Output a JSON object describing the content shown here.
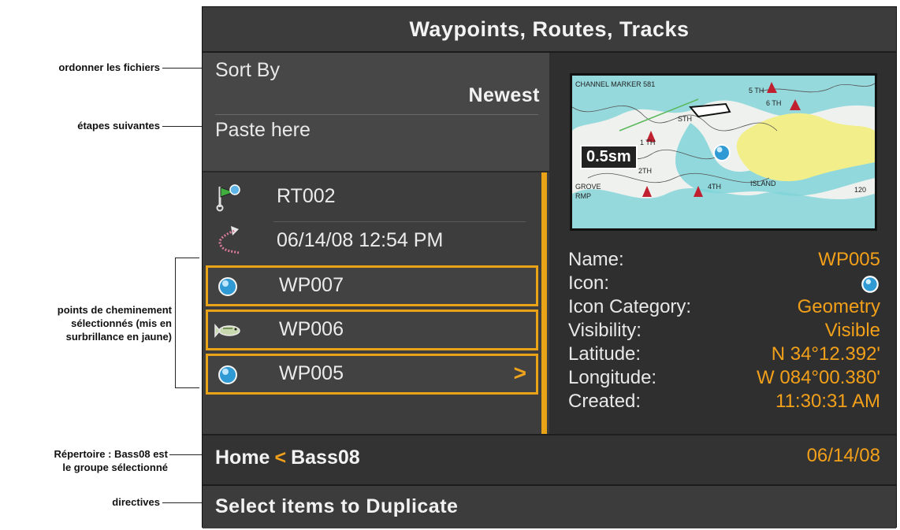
{
  "annotations": {
    "sort": "ordonner les fichiers",
    "paste": "étapes suivantes",
    "selected_line1": "points de cheminement",
    "selected_line2": "sélectionnés (mis en",
    "selected_line3": "surbrillance en jaune)",
    "directory_line1": "Répertoire : Bass08 est",
    "directory_line2": "le groupe sélectionné",
    "instructions": "directives"
  },
  "title": "Waypoints, Routes, Tracks",
  "sort": {
    "label": "Sort By",
    "value": "Newest"
  },
  "paste_label": "Paste here",
  "list": [
    {
      "label": "RT002",
      "icon": "route-icon",
      "selected": false
    },
    {
      "label": "06/14/08 12:54 PM",
      "icon": "track-icon",
      "selected": false
    },
    {
      "label": "WP007",
      "icon": "waypoint-ball-icon",
      "selected": true
    },
    {
      "label": "WP006",
      "icon": "fish-icon",
      "selected": true
    },
    {
      "label": "WP005",
      "icon": "waypoint-ball-icon",
      "selected": true,
      "arrow": ">"
    }
  ],
  "map": {
    "scale_label": "0.5sm",
    "labels": [
      "CHANNEL MARKER 581",
      "5 TH",
      "6 TH",
      "STH",
      "1 TH",
      "2TH",
      "4TH",
      "ISLAND",
      "GROVE",
      "RMP",
      "120"
    ]
  },
  "details": {
    "name_label": "Name:",
    "name_value": "WP005",
    "icon_label": "Icon:",
    "category_label": "Icon Category:",
    "category_value": "Geometry",
    "visibility_label": "Visibility:",
    "visibility_value": "Visible",
    "latitude_label": "Latitude:",
    "latitude_value": "N 34°12.392'",
    "longitude_label": "Longitude:",
    "longitude_value": "W 084°00.380'",
    "created_label": "Created:",
    "created_time": "11:30:31 AM",
    "created_date": "06/14/08"
  },
  "breadcrumb": {
    "home": "Home",
    "separator": "<",
    "group": "Bass08"
  },
  "instruction": "Select items to Duplicate",
  "colors": {
    "accent": "#e8a317",
    "background": "#2e2e2e",
    "text": "#ebebeb",
    "water": "#7fd3d8",
    "land": "#f2ef8a"
  }
}
